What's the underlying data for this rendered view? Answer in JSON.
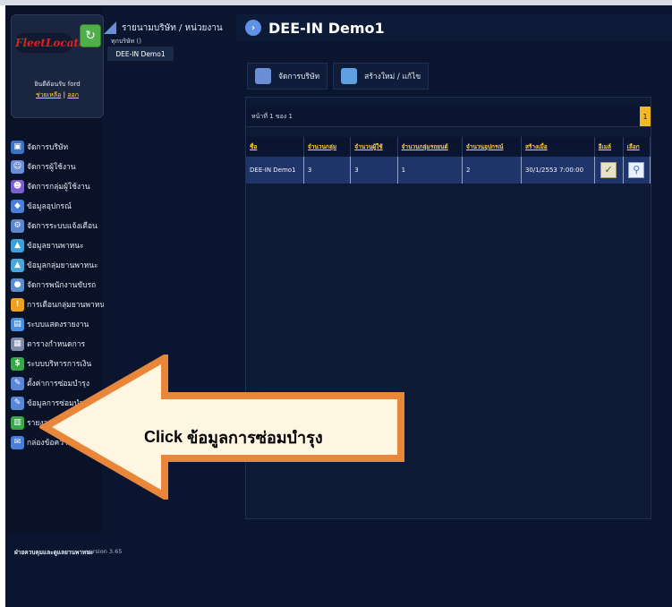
{
  "brand": {
    "logo_text": "FleetLocate",
    "welcome_text": "ยินดีต้อนรับ ford",
    "change_password_link": "ช่วยเหลือ",
    "separator": "|",
    "logout_link": "ออก"
  },
  "sidebar": {
    "items": [
      {
        "label": "จัดการบริษัท",
        "icon": "company-icon",
        "color": "#3a74c8"
      },
      {
        "label": "จัดการผู้ใช้งาน",
        "icon": "users-icon",
        "color": "#6b8fd6"
      },
      {
        "label": "จัดการกลุ่มผู้ใช้งาน",
        "icon": "user-group-icon",
        "color": "#7a5fd0"
      },
      {
        "label": "ข้อมูลอุปกรณ์",
        "icon": "device-icon",
        "color": "#4a7fd8"
      },
      {
        "label": "จัดการระบบแจ้งเตือน",
        "icon": "alert-settings-icon",
        "color": "#5e86cc"
      },
      {
        "label": "ข้อมูลยานพาหนะ",
        "icon": "vehicle-icon",
        "color": "#3fa0d8"
      },
      {
        "label": "ข้อมูลกลุ่มยานพาหนะ",
        "icon": "vehicle-group-icon",
        "color": "#4aa6d8"
      },
      {
        "label": "จัดการพนักงานขับรถ",
        "icon": "driver-icon",
        "color": "#5a8ed0"
      },
      {
        "label": "การเตือนกลุ่มยานพาหนะ",
        "icon": "warning-icon",
        "color": "#f0a020"
      },
      {
        "label": "ระบบแสดงรายงาน",
        "icon": "report-icon",
        "color": "#4a8fe0"
      },
      {
        "label": "ตารางกำหนดการ",
        "icon": "schedule-icon",
        "color": "#7d8aa8"
      },
      {
        "label": "ระบบบริหารการเงิน",
        "icon": "finance-icon",
        "color": "#3aa84a"
      },
      {
        "label": "ตั้งค่าการซ่อมบำรุง",
        "icon": "maintenance-settings-icon",
        "color": "#5a86d8"
      },
      {
        "label": "ข้อมูลการซ่อมบำรุง",
        "icon": "maintenance-data-icon",
        "color": "#5a86d8"
      },
      {
        "label": "รายงานจากอุปกรณ์",
        "icon": "device-report-icon",
        "color": "#3aa84a"
      },
      {
        "label": "กล่องข้อความ",
        "icon": "message-box-icon",
        "color": "#4a7fd8"
      }
    ]
  },
  "middle": {
    "crumb": "รายนามบริษัท / หน่วยงาน",
    "tree_label": "ทุกบริษัท ()",
    "tree_item": "DEE-IN Demo1"
  },
  "main": {
    "title": "DEE-IN Demo1",
    "tabs": [
      {
        "label": "จัดการบริษัท",
        "color": "#6b8fd6"
      },
      {
        "label": "สร้างใหม่ / แก้ไข",
        "color": "#5fa0e0"
      }
    ],
    "page_text": "หน้าที่ 1 ของ 1",
    "page_badge": "1",
    "table": {
      "headers": [
        "ชื่อ",
        "จำนวนกลุ่ม",
        "จำนวนผู้ใช้",
        "จำนวนกลุ่มรถยนต์",
        "จำนวนอุปกรณ์",
        "สร้างเมื่อ",
        "อีเมล์",
        "เลือก"
      ],
      "rows": [
        [
          "DEE-IN Demo1",
          "3",
          "3",
          "1",
          "2",
          "30/1/2553 7:00:00",
          "",
          ""
        ]
      ]
    }
  },
  "footer": {
    "bold": "ฝ่ายควบคุมและดูแลยานพาหนะ",
    "version": "version 3.65"
  },
  "annotation": {
    "click_word": "Click",
    "target": "ข้อมูลการซ่อมบำรุง",
    "arrow_fill": "#fef6e0",
    "arrow_stroke": "#e8863a"
  }
}
